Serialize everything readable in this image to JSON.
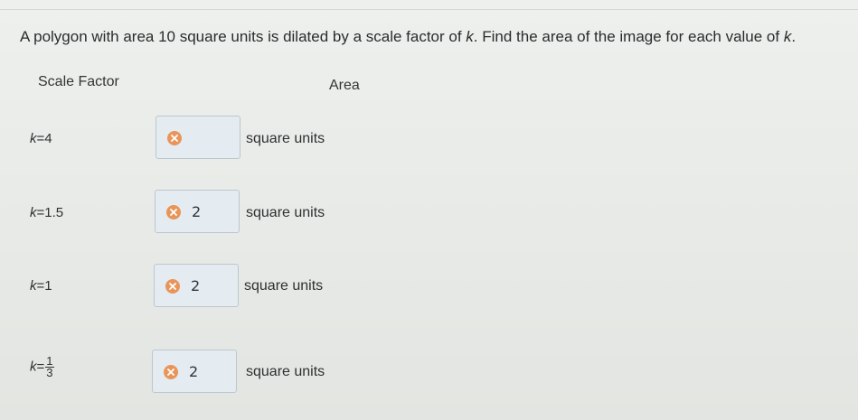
{
  "question": {
    "part1": "A polygon with area 10 square units is dilated by a scale factor of ",
    "var": "k",
    "part2": ". Find the area of the image for each value of ",
    "var2": "k",
    "part3": "."
  },
  "headers": {
    "scale_factor": "Scale Factor",
    "area": "Area"
  },
  "rows": [
    {
      "k_prefix": "k",
      "k_eq": "=",
      "k_value": "4",
      "answer": "",
      "units": "square units",
      "status": "incorrect"
    },
    {
      "k_prefix": "k",
      "k_eq": "=",
      "k_value": "1.5",
      "answer": "2",
      "units": "square units",
      "status": "incorrect"
    },
    {
      "k_prefix": "k",
      "k_eq": "=",
      "k_value": "1",
      "answer": "2",
      "units": "square units",
      "status": "incorrect"
    },
    {
      "k_prefix": "k",
      "k_eq": "=",
      "k_num": "1",
      "k_den": "3",
      "answer": "2",
      "units": "square units",
      "status": "incorrect"
    }
  ],
  "colors": {
    "incorrect_icon": "#e9955a",
    "input_bg": "#e4ecf1"
  },
  "icons": {
    "status": "x-circle-icon"
  }
}
